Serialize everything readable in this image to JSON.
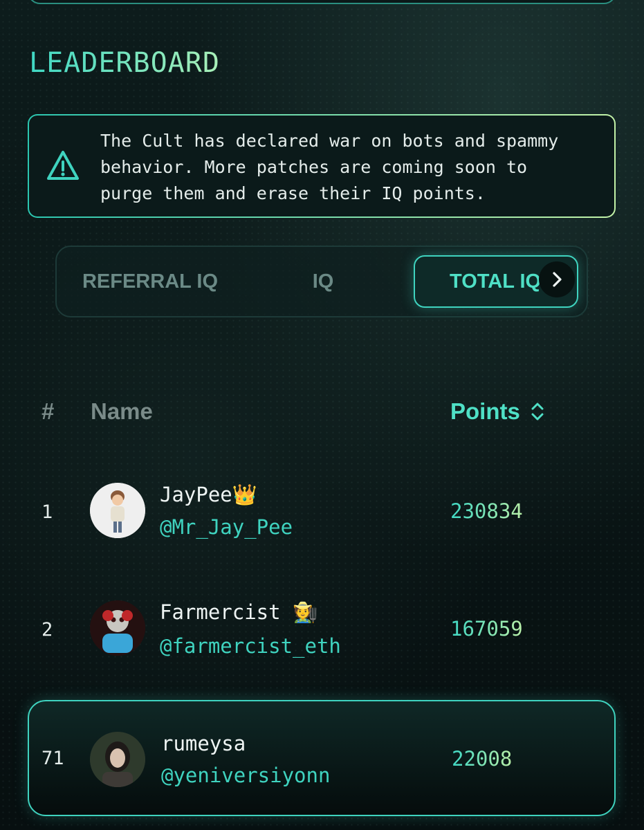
{
  "title": "LEADERBOARD",
  "notice": {
    "icon": "warning-icon",
    "text": "The Cult has declared war on bots and spammy behavior. More patches are coming soon to purge them and erase their IQ points."
  },
  "tabs": [
    {
      "label": "REFERRAL IQ",
      "active": false
    },
    {
      "label": "IQ",
      "active": false
    },
    {
      "label": "TOTAL IQ",
      "active": true
    }
  ],
  "scroll_icon": "chevron-right-icon",
  "table": {
    "headers": {
      "rank": "#",
      "name": "Name",
      "points": "Points"
    },
    "sort_icon": "sort-icon",
    "rows": [
      {
        "rank": "1",
        "name": "JayPee👑",
        "handle": "@Mr_Jay_Pee",
        "points": "230834"
      },
      {
        "rank": "2",
        "name": "Farmercist 🧑‍🌾",
        "handle": "@farmercist_eth",
        "points": "167059"
      },
      {
        "rank": "71",
        "name": "rumeysa",
        "handle": "@yeniversiyonn",
        "points": "22008",
        "current_user": true
      }
    ]
  },
  "colors": {
    "accent": "#3fd3bf",
    "accent_light": "#b9f0a8",
    "muted": "#7a8b89"
  }
}
